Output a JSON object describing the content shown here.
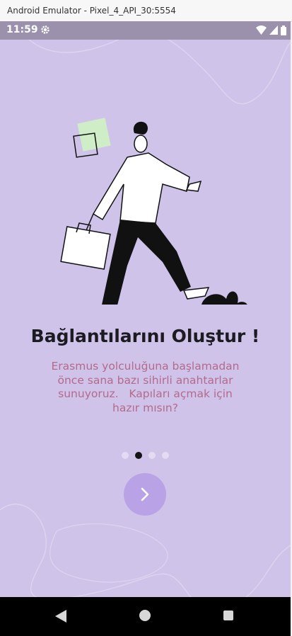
{
  "window": {
    "title": "Android Emulator - Pixel_4_API_30:5554"
  },
  "status_bar": {
    "time": "11:59",
    "icons": [
      "gear-icon",
      "wifi-icon",
      "signal-icon",
      "battery-icon"
    ]
  },
  "onboarding": {
    "title": "Bağlantılarını Oluştur !",
    "description": "Erasmus yolculuğuna başlamadan önce sana bazı sihirli anahtarlar sunuyoruz.   Kapıları açmak için hazır mısın?",
    "page_count": 4,
    "active_page": 2,
    "next_icon": "chevron-right-icon"
  },
  "colors": {
    "background": "#cfc3ea",
    "accent": "#b9a2e6",
    "title": "#1d1b22",
    "description": "#b46a8a"
  },
  "nav_bar": {
    "buttons": [
      "back-icon",
      "home-icon",
      "recents-icon"
    ]
  }
}
